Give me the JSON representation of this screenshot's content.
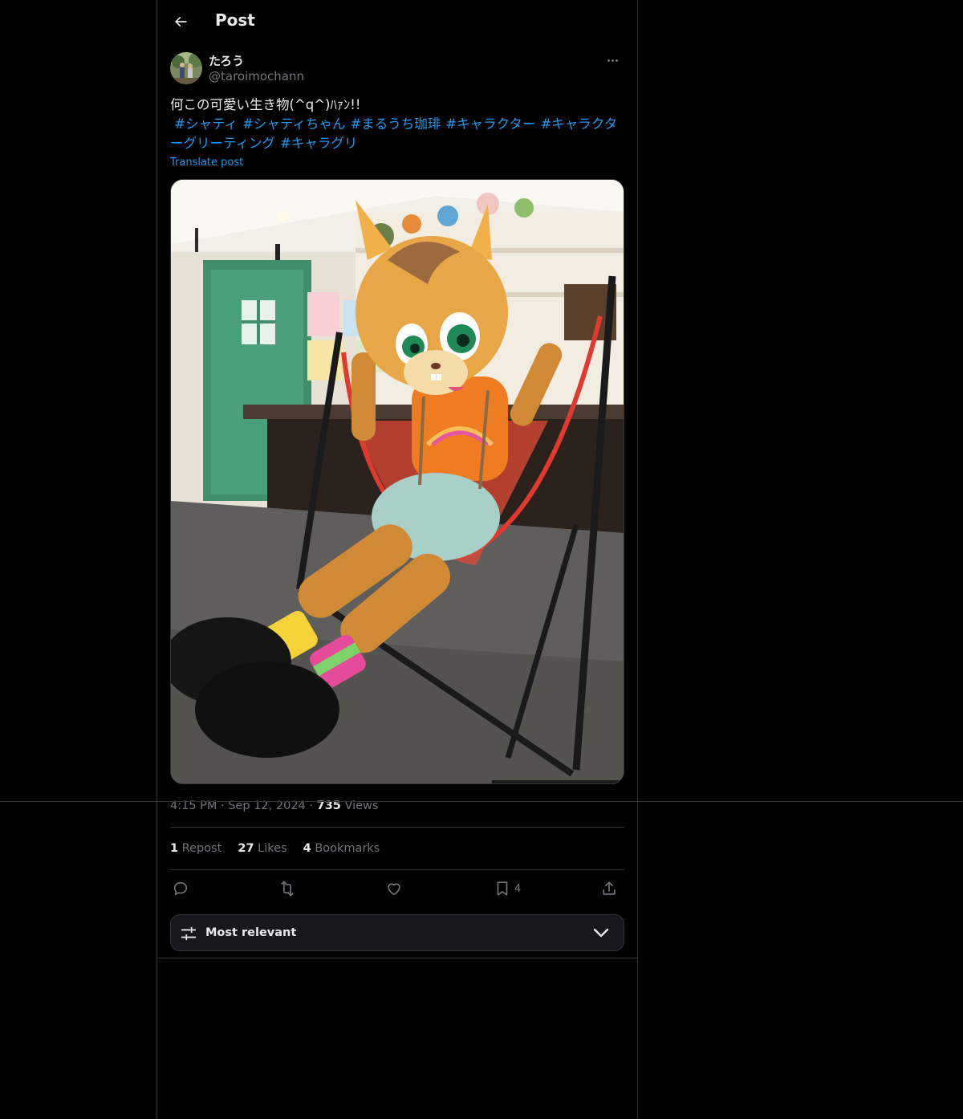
{
  "header": {
    "title": "Post",
    "back_icon": "arrow-left-icon"
  },
  "post": {
    "author": {
      "display_name": "たろう",
      "handle": "@taroimochann"
    },
    "text": "何この可愛い生き物(^q^)ﾊｧﾝ!!",
    "hashtags": [
      "#シャティ",
      "#シャティちゃん",
      "#まるうち珈琲",
      "#キャラクター",
      "#キャラクターグリーティング",
      "#キャラグリ"
    ],
    "translate_label": "Translate post",
    "time": "4:15 PM",
    "date": "Sep 12, 2024",
    "views_count": "735",
    "views_label": "Views",
    "separator": "·"
  },
  "stats": {
    "reposts_count": "1",
    "reposts_label": "Repost",
    "likes_count": "27",
    "likes_label": "Likes",
    "bookmarks_count": "4",
    "bookmarks_label": "Bookmarks"
  },
  "actions": {
    "reply_icon": "reply-icon",
    "repost_icon": "repost-icon",
    "like_icon": "heart-icon",
    "bookmark_icon": "bookmark-icon",
    "bookmark_count": "4",
    "share_icon": "share-icon"
  },
  "replies_sort": {
    "label": "Most relevant",
    "icon": "sliders-icon",
    "chevron": "chevron-down-icon"
  },
  "colors": {
    "background": "#000000",
    "text": "#e7e9ea",
    "muted": "#71767b",
    "accent": "#1d9bf0",
    "border": "#2f3336"
  }
}
